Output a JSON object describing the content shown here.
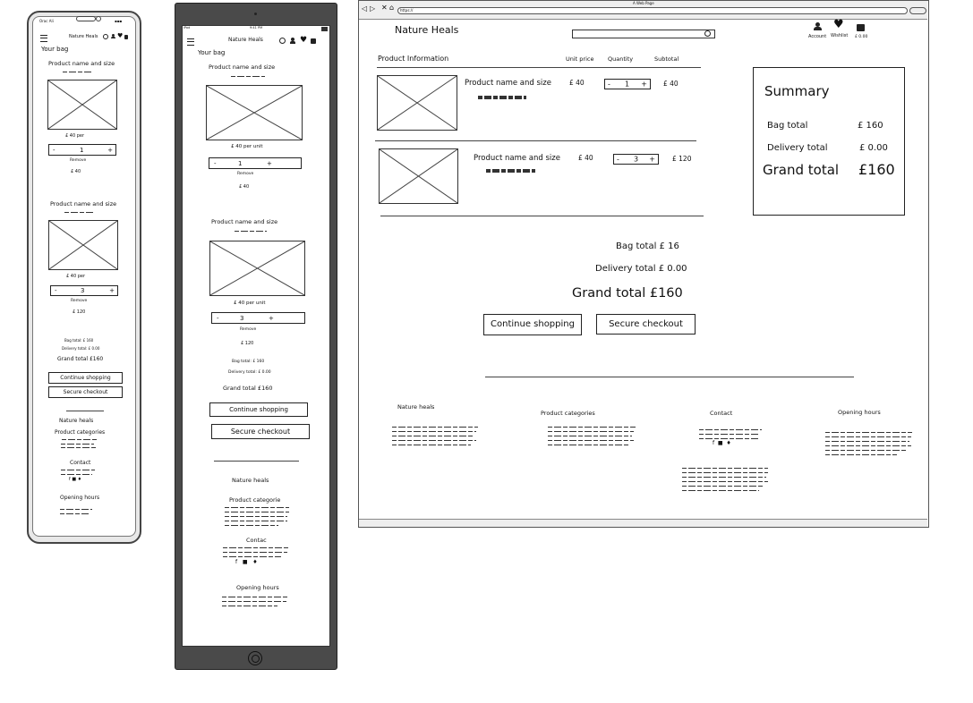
{
  "brand": "Nature Heals",
  "phone": {
    "status_left": "Orac Ali",
    "page_title": "Your bag",
    "product1": {
      "name": "Product name and size",
      "price": "£ 40 per",
      "qty": "1",
      "remove": "Remove",
      "subtotal": "£ 40"
    },
    "product2": {
      "name": "Product name and size",
      "price": "£ 40 per",
      "qty": "3",
      "remove": "Remove",
      "subtotal": "£ 120"
    },
    "bag_total": "Bag total: £ 160",
    "delivery_total": "Delivery total: £ 0.00",
    "grand_total": "Grand total £160",
    "continue_btn": "Continue shopping",
    "checkout_btn": "Secure checkout",
    "footer": {
      "brand": "Nature heals",
      "categories": "Product categories",
      "contact": "Contact",
      "hours": "Opening hours"
    }
  },
  "tablet": {
    "status_left": "iPad",
    "status_center": "9:41 PM",
    "page_title": "Your bag",
    "product1": {
      "name": "Product name and size",
      "price": "£ 40 per unit",
      "qty": "1",
      "remove": "Remove",
      "subtotal": "£ 40"
    },
    "product2": {
      "name": "Product name and size",
      "price": "£ 40 per unit",
      "qty": "3",
      "remove": "Remove",
      "subtotal": "£ 120"
    },
    "bag_total": "Bag total: £ 160",
    "delivery_total": "Delivery total: £ 0.00",
    "grand_total": "Grand total £160",
    "continue_btn": "Continue shopping",
    "checkout_btn": "Secure checkout",
    "footer": {
      "brand": "Nature heals",
      "categories": "Product categorie",
      "contact": "Contac",
      "hours": "Opening hours"
    }
  },
  "desktop": {
    "window_title": "A Web Page",
    "url": "https://",
    "nav": {
      "account": "Account",
      "wishlist": "Wishlist",
      "bag": "£ 0.00"
    },
    "table_headers": {
      "info": "Product Information",
      "unit_price": "Unit price",
      "quantity": "Quantity",
      "subtotal": "Subtotal"
    },
    "rows": [
      {
        "name": "Product name and size",
        "price": "£ 40",
        "qty": "1",
        "subtotal": "£ 40"
      },
      {
        "name": "Product name and size",
        "price": "£ 40",
        "qty": "3",
        "subtotal": "£ 120"
      }
    ],
    "summary": {
      "title": "Summary",
      "bag_label": "Bag total",
      "bag_value": "£ 160",
      "delivery_label": "Delivery total",
      "delivery_value": "£ 0.00",
      "grand_label": "Grand total",
      "grand_value": "£160"
    },
    "totals": {
      "bag": "Bag total  £ 16",
      "delivery": "Delivery total £ 0.00",
      "grand": "Grand total £160"
    },
    "continue_btn": "Continue shopping",
    "checkout_btn": "Secure checkout",
    "footer": {
      "brand": "Nature heals",
      "categories": "Product categories",
      "contact": "Contact",
      "hours": "Opening hours"
    }
  }
}
